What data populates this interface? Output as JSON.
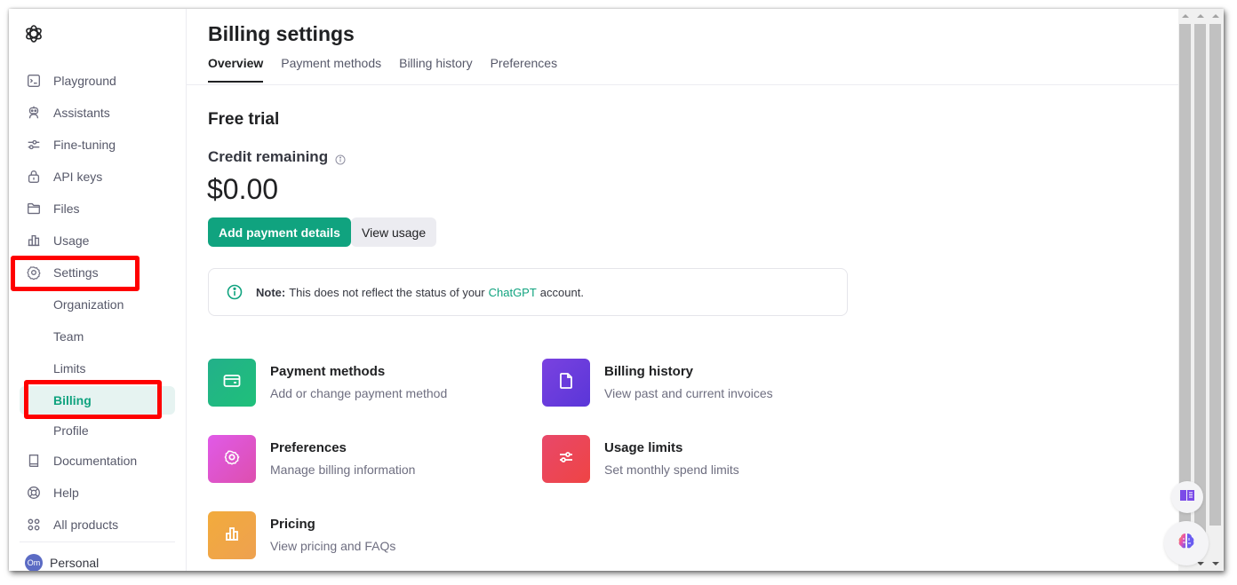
{
  "sidebar": {
    "logo": "openai-logo-icon",
    "items": [
      {
        "label": "Playground",
        "icon": "terminal-icon"
      },
      {
        "label": "Assistants",
        "icon": "robot-icon"
      },
      {
        "label": "Fine-tuning",
        "icon": "sliders-icon"
      },
      {
        "label": "API keys",
        "icon": "lock-icon"
      },
      {
        "label": "Files",
        "icon": "folder-icon"
      },
      {
        "label": "Usage",
        "icon": "bar-chart-icon"
      },
      {
        "label": "Settings",
        "icon": "gear-icon"
      }
    ],
    "settings_sub": [
      {
        "label": "Organization"
      },
      {
        "label": "Team"
      },
      {
        "label": "Limits"
      },
      {
        "label": "Billing",
        "active": true
      },
      {
        "label": "Profile"
      }
    ],
    "bottom_items": [
      {
        "label": "Documentation",
        "icon": "book-icon"
      },
      {
        "label": "Help",
        "icon": "lifebuoy-icon"
      },
      {
        "label": "All products",
        "icon": "grid-icon"
      }
    ],
    "account": {
      "avatar_initials": "Om",
      "label": "Personal"
    }
  },
  "main": {
    "title": "Billing settings",
    "tabs": [
      {
        "label": "Overview",
        "active": true
      },
      {
        "label": "Payment methods"
      },
      {
        "label": "Billing history"
      },
      {
        "label": "Preferences"
      }
    ],
    "plan_title": "Free trial",
    "credit_label": "Credit remaining",
    "credit_value": "$0.00",
    "buttons": {
      "add_payment": "Add payment details",
      "view_usage": "View usage"
    },
    "note": {
      "prefix": "Note:",
      "text_before": "This does not reflect the status of your",
      "link": "ChatGPT",
      "text_after": "account."
    },
    "cards": [
      {
        "title": "Payment methods",
        "desc": "Add or change payment method",
        "icon": "credit-card-icon",
        "color": "#1fb584"
      },
      {
        "title": "Billing history",
        "desc": "View past and current invoices",
        "icon": "document-icon",
        "color": "#6a3de0"
      },
      {
        "title": "Preferences",
        "desc": "Manage billing information",
        "icon": "gear-icon",
        "color": "#dd55d0"
      },
      {
        "title": "Usage limits",
        "desc": "Set monthly spend limits",
        "icon": "sliders-icon",
        "color": "#ec4656"
      },
      {
        "title": "Pricing",
        "desc": "View pricing and FAQs",
        "icon": "bar-chart-icon",
        "color": "#f0a640"
      }
    ]
  },
  "colors": {
    "accent": "#10a37f",
    "annotation": "#ff0000"
  }
}
